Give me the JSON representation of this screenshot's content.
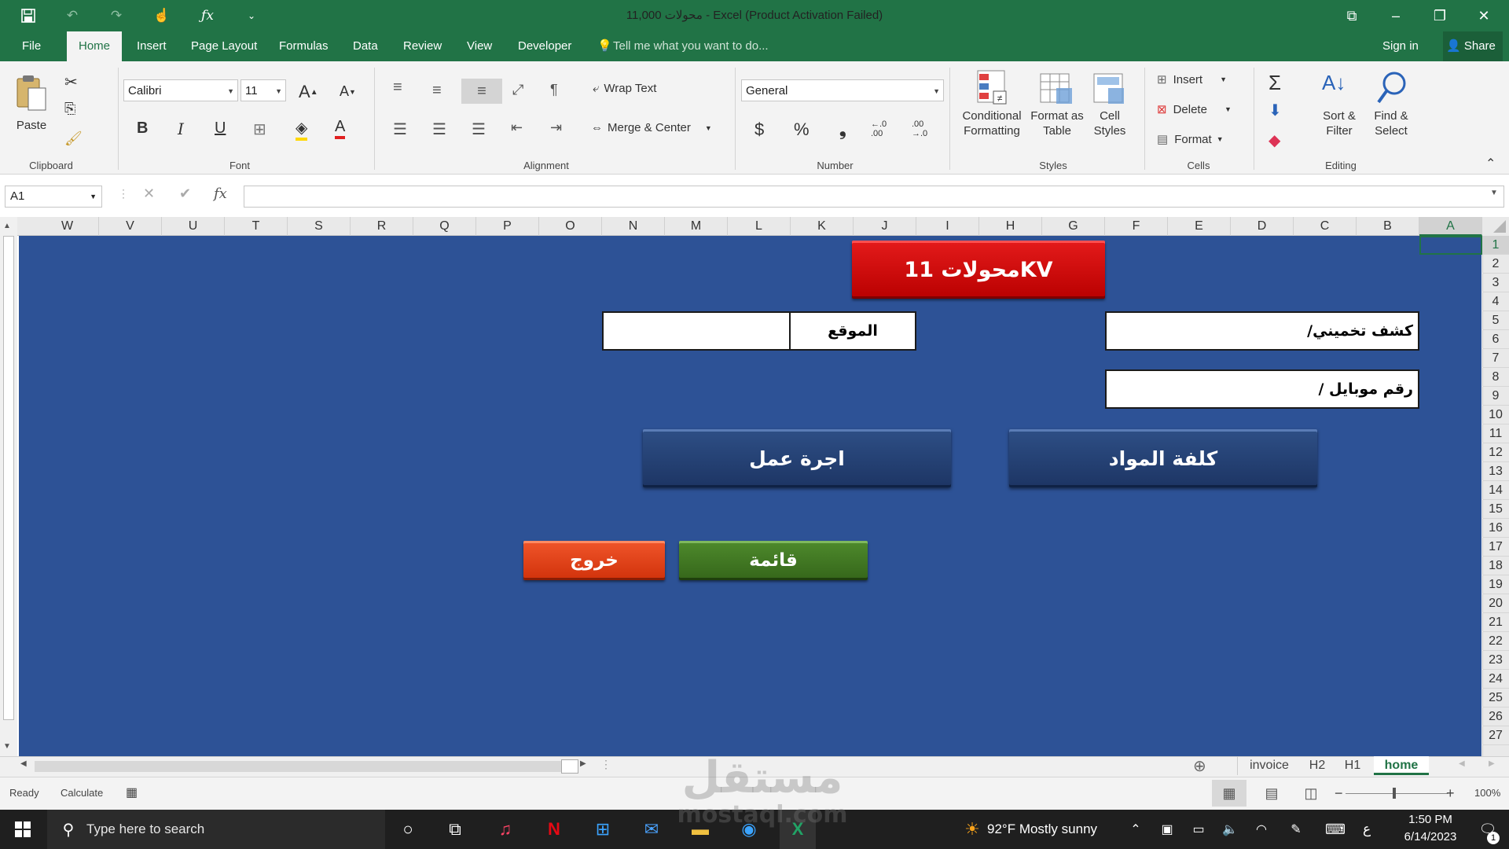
{
  "window": {
    "title": "محولات 11,000 - Excel (Product Activation Failed)",
    "controls": [
      "restore-icon",
      "minimize-icon",
      "maximize-icon",
      "close-icon"
    ]
  },
  "qat": [
    "save-icon",
    "undo-icon",
    "redo-icon",
    "touch-mode-icon",
    "fx-icon",
    "customize-icon"
  ],
  "menu": {
    "tabs": [
      "File",
      "Home",
      "Insert",
      "Page Layout",
      "Formulas",
      "Data",
      "Review",
      "View",
      "Developer"
    ],
    "active": "Home",
    "tell_me": "Tell me what you want to do...",
    "sign_in": "Sign in",
    "share": "Share"
  },
  "ribbon": {
    "clipboard": {
      "label": "Clipboard",
      "paste": "Paste"
    },
    "font": {
      "label": "Font",
      "name": "Calibri",
      "size": "11",
      "bold": "B",
      "italic": "I",
      "underline": "U"
    },
    "alignment": {
      "label": "Alignment",
      "wrap": "Wrap Text",
      "merge": "Merge & Center"
    },
    "number": {
      "label": "Number",
      "format": "General",
      "currency": "$",
      "percent": "%",
      "comma": "❟",
      "inc_decimal": "←.0\n.00",
      "dec_decimal": ".00\n→.0"
    },
    "styles": {
      "label": "Styles",
      "conditional": "Conditional\nFormatting",
      "format_table": "Format as\nTable",
      "cell_styles": "Cell\nStyles"
    },
    "cells": {
      "label": "Cells",
      "insert": "Insert",
      "delete": "Delete",
      "format": "Format"
    },
    "editing": {
      "label": "Editing",
      "sort": "Sort &\nFilter",
      "find": "Find &\nSelect"
    }
  },
  "formula_bar": {
    "name_box": "A1",
    "fx": "fx",
    "value": ""
  },
  "columns": [
    "W",
    "V",
    "U",
    "T",
    "S",
    "R",
    "Q",
    "P",
    "O",
    "N",
    "M",
    "L",
    "K",
    "J",
    "I",
    "H",
    "G",
    "F",
    "E",
    "D",
    "C",
    "B",
    "A"
  ],
  "rows": [
    "1",
    "2",
    "3",
    "4",
    "5",
    "6",
    "7",
    "8",
    "9",
    "10",
    "11",
    "12",
    "13",
    "14",
    "15",
    "16",
    "17",
    "18",
    "19",
    "20",
    "21",
    "22",
    "23",
    "24",
    "25",
    "26",
    "27"
  ],
  "sheet": {
    "background": "#2d5296",
    "title_button": "محولات 11KV",
    "site_label": "الموقع",
    "site_value": "",
    "estimate_label": "كشف تخميني/",
    "mobile_label": "رقم موبايل /",
    "labor_button": "اجرة عمل",
    "materials_button": "كلفة المواد",
    "exit_button": "خروج",
    "menu_button": "قائمة"
  },
  "sheet_tabs": [
    "invoice",
    "H2",
    "H1",
    "home"
  ],
  "active_sheet": "home",
  "status": {
    "ready": "Ready",
    "calculate": "Calculate",
    "zoom": "100%"
  },
  "taskbar": {
    "search_placeholder": "Type here to search",
    "weather": "92°F  Mostly sunny",
    "lang": "ع",
    "time": "1:50 PM",
    "date": "6/14/2023",
    "notifications": "1"
  },
  "watermark": {
    "arabic": "مستقل",
    "latin": "mostaql.com"
  }
}
